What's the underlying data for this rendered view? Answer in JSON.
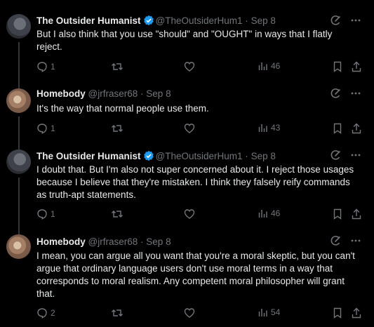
{
  "tweets": [
    {
      "name": "The Outsider Humanist",
      "handle": "@TheOutsiderHum1",
      "sep": "·",
      "date": "Sep 8",
      "verified": true,
      "text": "But I also think that you use \"should\" and \"OUGHT\" in ways that I flatly reject.",
      "replies": "1",
      "views": "46"
    },
    {
      "name": "Homebody",
      "handle": "@jrfraser68",
      "sep": "·",
      "date": "Sep 8",
      "verified": false,
      "text": "It's the way that normal people use them.",
      "replies": "1",
      "views": "43"
    },
    {
      "name": "The Outsider Humanist",
      "handle": "@TheOutsiderHum1",
      "sep": "·",
      "date": "Sep 8",
      "verified": true,
      "text": "I doubt that. But I'm also not super concerned about it. I reject those usages because I believe that they're mistaken. I think they falsely reify commands as truth-apt statements.",
      "replies": "1",
      "views": "46"
    },
    {
      "name": "Homebody",
      "handle": "@jrfraser68",
      "sep": "·",
      "date": "Sep 8",
      "verified": false,
      "text": "I mean, you can argue all you want that you're a moral skeptic, but you can't argue that ordinary language users don't use moral terms in a way that corresponds to moral realism. Any competent moral philosopher will grant that.",
      "replies": "2",
      "views": "54"
    }
  ],
  "colors": {
    "background": "#000000",
    "text": "#e7e9ea",
    "muted": "#71767b",
    "verified": "#1d9bf0",
    "divider": "#2f3336"
  },
  "icons": [
    "grok-icon",
    "more-icon",
    "reply-icon",
    "retweet-icon",
    "like-icon",
    "views-icon",
    "bookmark-icon",
    "share-icon",
    "verified-badge-icon"
  ]
}
